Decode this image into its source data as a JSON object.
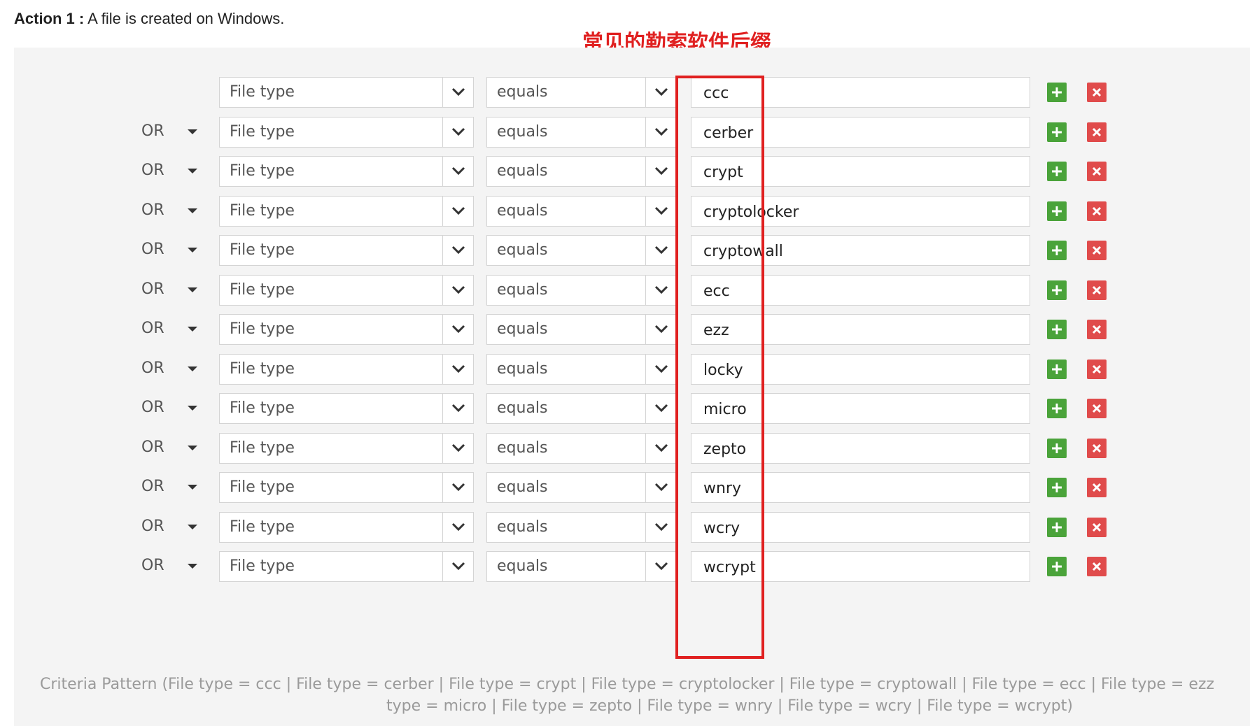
{
  "header": {
    "action_label": "Action 1 :",
    "description": "A file is created on Windows."
  },
  "annotation": "常见的勒索软件后缀",
  "rows": [
    {
      "connector": "",
      "field": "File type",
      "operator": "equals",
      "value": "ccc"
    },
    {
      "connector": "OR",
      "field": "File type",
      "operator": "equals",
      "value": "cerber"
    },
    {
      "connector": "OR",
      "field": "File type",
      "operator": "equals",
      "value": "crypt"
    },
    {
      "connector": "OR",
      "field": "File type",
      "operator": "equals",
      "value": "cryptolocker"
    },
    {
      "connector": "OR",
      "field": "File type",
      "operator": "equals",
      "value": "cryptowall"
    },
    {
      "connector": "OR",
      "field": "File type",
      "operator": "equals",
      "value": "ecc"
    },
    {
      "connector": "OR",
      "field": "File type",
      "operator": "equals",
      "value": "ezz"
    },
    {
      "connector": "OR",
      "field": "File type",
      "operator": "equals",
      "value": "locky"
    },
    {
      "connector": "OR",
      "field": "File type",
      "operator": "equals",
      "value": "micro"
    },
    {
      "connector": "OR",
      "field": "File type",
      "operator": "equals",
      "value": "zepto"
    },
    {
      "connector": "OR",
      "field": "File type",
      "operator": "equals",
      "value": "wnry"
    },
    {
      "connector": "OR",
      "field": "File type",
      "operator": "equals",
      "value": "wcry"
    },
    {
      "connector": "OR",
      "field": "File type",
      "operator": "equals",
      "value": "wcrypt"
    }
  ],
  "criteria_pattern": {
    "line1": "Criteria Pattern (File type = ccc | File type = cerber | File type = crypt | File type = cryptolocker | File type = cryptowall | File type = ecc | File type = ezz",
    "line2": "type = micro | File type = zepto | File type = wnry | File type = wcry | File type = wcrypt)"
  },
  "colors": {
    "add": "#4aa33a",
    "delete": "#e04b4b",
    "highlight": "#e02020"
  }
}
